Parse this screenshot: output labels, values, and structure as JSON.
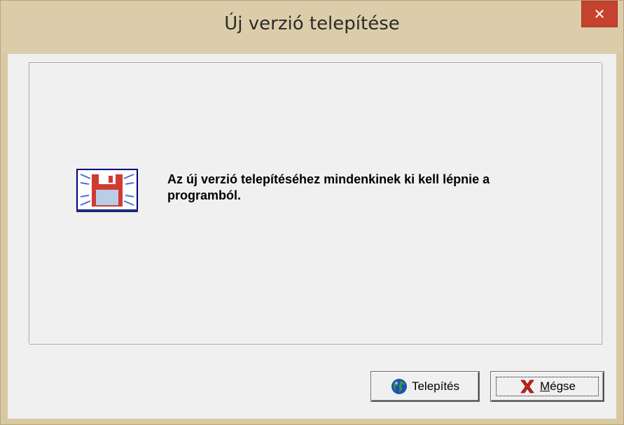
{
  "window": {
    "title": "Új verzió telepítése",
    "close_glyph": "✕"
  },
  "dialog": {
    "message": "Az új verzió telepítéséhez mindenkinek ki kell lépnie a programból.",
    "icon": "floppy-disk-icon"
  },
  "buttons": {
    "install_label": "Telepítés",
    "install_icon": "globe-icon",
    "cancel_label": "Mégse",
    "cancel_icon": "red-x-icon"
  },
  "colors": {
    "titlebar": "#dccdaa",
    "close_button": "#c5432e",
    "client": "#f0f0f0"
  }
}
